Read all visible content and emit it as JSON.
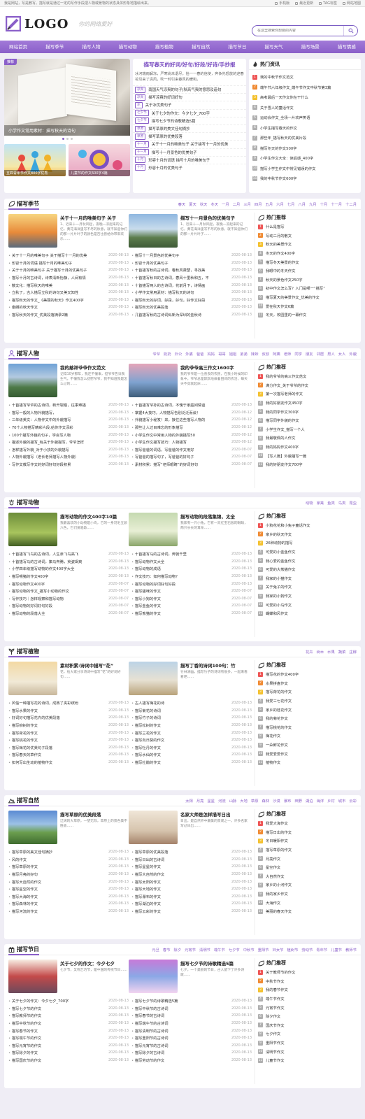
{
  "topbar": {
    "left": "我是网站，写是教写。描写就是通过一定的写作手段把人物或景物的状态具体形象地描绘出来。",
    "links": [
      "手机版",
      "最近更新",
      "TAG标签",
      "网站地图"
    ]
  },
  "header": {
    "logo": "LOGO",
    "slogan": "你的网络爱好",
    "search_placeholder": "在这里搜索你想要的内容"
  },
  "nav": [
    "网站首页",
    "描写季节",
    "描写人物",
    "描写动物",
    "描写植物",
    "描写自然",
    "描写节日",
    "描写天气",
    "描写场景",
    "描写情感"
  ],
  "hero": {
    "badge": "推荐",
    "caption": "小学作文常用素材：描写秋天的诗句",
    "thumbs": [
      "五四青年节作文800字优秀",
      "儿童节的作文600字4篇"
    ]
  },
  "center": {
    "title": "描写春天的好词/好句/好段/好诗/手抄报",
    "desc": "冰河瑞雨解冻，严寒尚未退尽，恰一一春的信使，奔争先怒放的迎春花引来了清风，吹一时引来春风的暖和。",
    "items": [
      {
        "tag": "凉爽",
        "text": "南国天气凉爽的句子|秋高气爽的意思及造句"
      },
      {
        "tag": "凉爽",
        "text": "描写凉爽的好词好句"
      },
      {
        "tag": "冰",
        "text": "关于冰优美句子"
      },
      {
        "tag": "七夕节",
        "text": "关于七夕的作文：今夕七夕_700字"
      },
      {
        "tag": "七夕节",
        "text": "描写七夕节的诗歌精选5篇"
      },
      {
        "tag": "草原",
        "text": "描写草原的美文佳句摘抄"
      },
      {
        "tag": "草原",
        "text": "描写草原的优美段落"
      },
      {
        "tag": "十一月",
        "text": "关于十一月的唯美句子 关于描写十一月的优美"
      },
      {
        "tag": "十一月",
        "text": "描写十一月景色的优美句子"
      },
      {
        "tag": "十月",
        "text": "形容十月的词语 描写十月的唯美句子"
      },
      {
        "tag": "十月",
        "text": "形容十月的优美句子"
      }
    ]
  },
  "hot": {
    "title": "热门资讯",
    "items": [
      "我的中秋节作文范文",
      "端午节六年级作文_端午节作文中秋节第3篇",
      "高考最后一天作文你在干什么",
      "关于雪人的童话作文",
      "运动会作文_全场一片欢声笑语",
      "小学生描写春天的作文",
      "那些年_描写秋天的优美片段",
      "描写冬天的作文500字",
      "小学生作文大全：读后感_400字",
      "描写小学生作文中常见错误的作文",
      "我的中秋节作文600字"
    ]
  },
  "sections": [
    {
      "title": "描写季节",
      "tags": [
        "春天",
        "夏天",
        "秋天",
        "冬天",
        "一月",
        "二月",
        "三月",
        "四月",
        "五月",
        "六月",
        "七月",
        "八月",
        "九月",
        "十月",
        "十一月",
        "十二月"
      ],
      "feat": [
        {
          "title": "关于十一月的唯美句子 关于",
          "desc": "1、近来十一月秋风起，夜晚一凉起来的记忆，黄花海洋里写不尽的秋意，就不知道你们的那一片片叶子的颜色是否也曾给你带来欢乐……"
        },
        {
          "title": "描写十一月景色的优美句子",
          "desc": "1、近来十一月秋风起，夜晚一凉起来的记忆，黄花海洋里写不尽的秋意，就不知道你们的那一片片叶子……"
        }
      ],
      "list1": [
        {
          "t": "关于十一月的唯美句子 关于描写十一月的优美",
          "d": "2020-08-13"
        },
        {
          "t": "形容十月的词语 描写十月的唯美句子",
          "d": "2020-08-13"
        },
        {
          "t": "关于十月的唯美句子 关于描写十月的优美句子",
          "d": "2020-08-13"
        },
        {
          "t": "描写十月的古诗词，诗表清新怡静，人间有情",
          "d": "2020-08-13"
        },
        {
          "t": "散文化：描写秋天的唯美",
          "d": "2020-08-13"
        },
        {
          "t": "立秋了，古人描写立秋的诗句又美又知性",
          "d": "2020-08-13"
        },
        {
          "t": "描写秋天的作文_《美丽的秋天》作文400字",
          "d": "2020-08-13"
        },
        {
          "t": "秦朗的秋天作文",
          "d": "2020-08-13"
        },
        {
          "t": "描写秋天的作文_优美段落摘录2篇",
          "d": "2020-08-13"
        }
      ],
      "list2": [
        {
          "t": "描写十一月景色的优美句子",
          "d": "2020-08-13"
        },
        {
          "t": "形容十月的优美句子",
          "d": "2020-08-13"
        },
        {
          "t": "十首描写秋的古诗词，看秋风萧瑟，寻找美",
          "d": "2020-08-13"
        },
        {
          "t": "十首描写秋日的古诗词，春风十里秋和五，不",
          "d": "2020-08-13"
        },
        {
          "t": "十首描写两人的古诗词，花前月下，诗情画",
          "d": "2020-08-13"
        },
        {
          "t": "小学作文常用素材：描写秋天的诗句",
          "d": "2020-08-13"
        },
        {
          "t": "描写秋天的好词，好段，好句，好作文好段",
          "d": "2020-08-13"
        },
        {
          "t": "描写秋天的优美段落",
          "d": "2020-08-13"
        },
        {
          "t": "几首描写秋的古诗词似新为深圳的金秋诗",
          "d": "2020-08-13"
        }
      ],
      "rec": [
        "什么是描写",
        "写动二月的散文",
        "秋天的美景作文",
        "冬天的作文400字",
        "描写冬天美景的作文",
        "我眼中的冬天作文",
        "秋天的景色作文250字",
        "初中作文怎么写？入门是哪一“描写”",
        "描写夏天的美景作文_优美的作文",
        "爱在秋天作文6篇",
        "冬天，校园里的一幕作文"
      ]
    },
    {
      "title": "描写人物",
      "tags": [
        "爷爷",
        "奶奶",
        "外公",
        "外婆",
        "爸爸",
        "妈妈",
        "哥哥",
        "姐姐",
        "弟弟",
        "妹妹",
        "叔叔",
        "阿姨",
        "老师",
        "同学",
        "朋友",
        "邻居",
        "男人",
        "女人",
        "外貌"
      ],
      "feat": [
        {
          "title": "我的慈祥爷爷作文范文",
          "desc": "记得10岁那年，我还不懂事，但爷爷告诉我生气，不懂我怎么抚慰爷爷，我不知道我是怎么过的……"
        },
        {
          "title": "我的爷爷高三作文1600字",
          "desc": "我的爷爷是一位善良的农民，在我小时候的印象中，爷爷总是默默地做着田间的农活，每天天不亮就起床……"
        }
      ],
      "list1": [
        {
          "t": "十首描写爷爷的古诗词，新开裂痕，往事难描",
          "d": "2020-08-13"
        },
        {
          "t": "描写一般的人物外貌描写，",
          "d": "2020-08-13"
        },
        {
          "t": "三年级美文：人物作文中的外貌描写",
          "d": "2020-08-13"
        },
        {
          "t": "70个人物描写精彩片段,给你作文添彩",
          "d": "2020-08-13"
        },
        {
          "t": "100个描写外貌的句子，学会写人物",
          "d": "2020-08-13"
        },
        {
          "t": "描述外貌的描写_有关于外貌描写，爷爷怎样",
          "d": "2020-08-13"
        },
        {
          "t": "怎样描写外貌_对于小孩的外貌描写",
          "d": "2020-08-13"
        },
        {
          "t": "人物外貌描写（老长老师描写人物外貌）",
          "d": "2020-08-13"
        },
        {
          "t": "写作文教写作文的好词好句好段积累",
          "d": "2020-08-13"
        }
      ],
      "list2": [
        {
          "t": "十首描写爷孙的古诗词，不愧于家庭间情谊",
          "d": "2020-08-13"
        },
        {
          "t": "掌握4大技巧，人物描写告别泛泛而谈！",
          "d": "2020-08-12"
        },
        {
          "t": "外貌描写小秘笈！来，接住这些描写人物的",
          "d": "2020-08-12"
        },
        {
          "t": "那些让人过目难忘的形象描写",
          "d": "2020-08-12"
        },
        {
          "t": "小学生作文中常用人物的外貌描写50",
          "d": "2020-08-12"
        },
        {
          "t": "小学生作文描写技巧：人物描写",
          "d": "2020-08-12"
        },
        {
          "t": "描写爸爸的词语，写爸爸的作文用好",
          "d": "2020-08-07"
        },
        {
          "t": "写爸爸的描写句子，写爸爸的好句子",
          "d": "2020-08-07"
        },
        {
          "t": "素材积累：描写“老师眼睛”的好词好句",
          "d": "2020-08-07"
        }
      ],
      "rec": [
        "我的爷爷的高三作文范文",
        "满分作文_关于爷爷的作文",
        "第一次描写老师的作文",
        "我的好朋友作文450字",
        "我的同学作文300字",
        "描写同学外貌的作文",
        "小学生作文_描写一个人",
        "我最敬佩的人作文",
        "我的妈妈作文400字",
        "【写人篇】外貌描写一篇",
        "我的好朋友作文700字"
      ]
    },
    {
      "title": "描写动物",
      "tags": [
        "动物",
        "家禽",
        "鱼类",
        "鸟类",
        "昆虫"
      ],
      "feat": [
        {
          "title": "描写动物的作文400字10篇",
          "desc": "我最喜欢的小动物是小鸟，它的一身羽毛五颜六色，它们爱唱歌……"
        },
        {
          "title": "描写动物的段落集锦，太全",
          "desc": "我家有一只小兔，它有一双红宝石般的眼睛，两只长长的耳朵……"
        }
      ],
      "list1": [
        {
          "t": "十首描写飞鸟的古诗词，人生亲飞鸟高飞",
          "d": "2020-08-13"
        },
        {
          "t": "十首描写马的古诗词，策马奔腾，英姿飒爽",
          "d": "2020-08-13"
        },
        {
          "t": "小学四年级描写动物的作文400字大全",
          "d": "2020-08-13"
        },
        {
          "t": "描写喂猪的作文400字",
          "d": "2020-08-13"
        },
        {
          "t": "描写动物作文400字",
          "d": "2020-08-07"
        },
        {
          "t": "描写动物的作文_描写小动物的作文",
          "d": "2020-08-07"
        },
        {
          "t": "写作技巧｜怎样观察和描写动物",
          "d": "2020-08-07"
        },
        {
          "t": "描写动物的好词好句好段",
          "d": "2020-08-07"
        },
        {
          "t": "描写动物的段落大全",
          "d": "2020-08-07"
        }
      ],
      "list2": [
        {
          "t": "十首描写马的古诗词，奔驰千里",
          "d": "2020-08-13"
        },
        {
          "t": "描写动物作文大全",
          "d": "2020-08-13"
        },
        {
          "t": "描写动物的成语",
          "d": "2020-08-13"
        },
        {
          "t": "作文技巧：如何描写动物？",
          "d": "2020-08-13"
        },
        {
          "t": "描写动物的好词好句好段",
          "d": "2020-08-13"
        },
        {
          "t": "描写猫咪的作文",
          "d": "2020-08-07"
        },
        {
          "t": "描写小狗的作文",
          "d": "2020-08-07"
        },
        {
          "t": "描写金鱼的作文",
          "d": "2020-08-07"
        },
        {
          "t": "描写熊猫的作文",
          "d": "2020-08-07"
        }
      ],
      "rec": [
        "小狗花花和小兔子童话作文",
        "家乡的秋天作文",
        "26种动物的描写",
        "可爱的小金鱼作文",
        "我心爱的金鱼作文",
        "可爱的大熊猫作文",
        "我家的小猫作文",
        "关于兔子的作文",
        "我家的小狗作文",
        "可爱的小鸟作文",
        "蝴蝶和风作文"
      ]
    },
    {
      "title": "描写植物",
      "tags": [
        "花卉",
        "树木",
        "水果",
        "蔬菜",
        "庄稼"
      ],
      "feat": [
        {
          "title": "素材积累:诗词中描写“花”",
          "desc": "花，给大家分享诗词中描写“花”的好词好句……"
        },
        {
          "title": "描写丁香的诗词100句：竹",
          "desc": "竹林清幽，描写竹子的诗词有很多，一起来看看吧……"
        }
      ],
      "list1": [
        {
          "t": "风信一种描写花的诗词，成熟了夹彩缤纷",
          "d": "2020-08-13"
        },
        {
          "t": "描写水果的作文",
          "d": "2020-08-13"
        },
        {
          "t": "好词好句描写花卉的优美段落",
          "d": "2020-08-13"
        },
        {
          "t": "描写柳树的作文",
          "d": "2020-08-13"
        },
        {
          "t": "描写荷花的作文",
          "d": "2020-08-13"
        },
        {
          "t": "描写桃花的作文",
          "d": "2020-08-13"
        },
        {
          "t": "描写梅花的优美句子段落",
          "d": "2020-08-13"
        },
        {
          "t": "描写春天的草作文",
          "d": "2020-08-13"
        },
        {
          "t": "如何写出生动的植物作文",
          "d": "2020-08-13"
        }
      ],
      "list2": [
        {
          "t": "古人描写梅花的诗",
          "d": "2020-08-13"
        },
        {
          "t": "描写菊花的诗词",
          "d": "2020-08-13"
        },
        {
          "t": "描写竹子的诗词",
          "d": "2020-08-13"
        },
        {
          "t": "描写松树的作文",
          "d": "2020-08-13"
        },
        {
          "t": "描写兰花的作文",
          "d": "2020-08-13"
        },
        {
          "t": "描写向日葵的作文",
          "d": "2020-08-13"
        },
        {
          "t": "描写牡丹的作文",
          "d": "2020-08-13"
        },
        {
          "t": "描写水仙的作文",
          "d": "2020-08-13"
        },
        {
          "t": "描写杜鹃的作文",
          "d": "2020-08-13"
        }
      ],
      "rec": [
        "描写花的作文400字",
        "水果拼盘作文",
        "描写荷花的作文",
        "我爱三七花作文",
        "家乡的桂花作文",
        "我的菊花作文",
        "描写桃花的作文",
        "梅花作文",
        "一朵鲜花作文",
        "我爱爱爱作文",
        "植物作文"
      ]
    },
    {
      "title": "描写自然",
      "tags": [
        "太阳",
        "月亮",
        "星星",
        "河流",
        "山脉",
        "大地",
        "草原",
        "森林",
        "沙漠",
        "瀑布",
        "田野",
        "湖泊",
        "海洋",
        "乡村",
        "城市",
        "云彩"
      ],
      "feat": [
        {
          "title": "描写草原的优美段落",
          "desc": "辽阔的大草原，一望无际，草原上的景色美不胜收……"
        },
        {
          "title": "名家大师是怎样描写日出",
          "desc": "日出，是自然界中最美的景观之一，许多名家写过日出……"
        }
      ],
      "list1": [
        {
          "t": "描写草原的美文佳句摘抄",
          "d": "2020-08-13"
        },
        {
          "t": "风的作文",
          "d": "2020-08-13"
        },
        {
          "t": "描写草原的作文",
          "d": "2020-08-13"
        },
        {
          "t": "描写月亮的好句",
          "d": "2020-08-13"
        },
        {
          "t": "描写大自然的作文",
          "d": "2020-08-13"
        },
        {
          "t": "描写星空的作文",
          "d": "2020-08-13"
        },
        {
          "t": "描写大海的作文",
          "d": "2020-08-13"
        },
        {
          "t": "描写森林的作文",
          "d": "2020-08-13"
        },
        {
          "t": "描写河流的作文",
          "d": "2020-08-13"
        }
      ],
      "list2": [
        {
          "t": "描写草原的优美段落",
          "d": "2020-08-13"
        },
        {
          "t": "描写日出的古诗词",
          "d": "2020-08-13"
        },
        {
          "t": "描写星星的作文",
          "d": "2020-08-13"
        },
        {
          "t": "描写大自然的作文",
          "d": "2020-08-13"
        },
        {
          "t": "描写太阳的作文",
          "d": "2020-08-13"
        },
        {
          "t": "描写大地的作文",
          "d": "2020-08-13"
        },
        {
          "t": "描写瀑布的作文",
          "d": "2020-08-13"
        },
        {
          "t": "描写湖泊的作文",
          "d": "2020-08-13"
        },
        {
          "t": "描写云彩的作文",
          "d": "2020-08-13"
        }
      ],
      "rec": [
        "我爱大海作文",
        "描写日出的作文",
        "冬日暖阳作文",
        "描写草原的作文",
        "月亮作文",
        "星空作文",
        "大自然作文",
        "家乡的小河作文",
        "我的家乡作文",
        "大海作文",
        "美丽的春天作文"
      ]
    },
    {
      "title": "描写节日",
      "tags": [
        "元旦",
        "春节",
        "除夕",
        "元宵节",
        "清明节",
        "端午节",
        "七夕节",
        "中秋节",
        "重阳节",
        "妇女节",
        "植树节",
        "劳动节",
        "青年节",
        "儿童节",
        "教师节"
      ],
      "feat": [
        {
          "title": "关于七夕的作文：今夕七夕",
          "desc": "七夕节，又称乞巧节，是中国的传统节日……"
        },
        {
          "title": "描写七夕节的诗歌精选5篇",
          "desc": "七夕，一个美丽的节日，古人留下了许多诗歌……"
        }
      ],
      "list1": [
        {
          "t": "关于七夕的作文：今夕七夕_700字",
          "d": "2020-08-13"
        },
        {
          "t": "描写七夕节的作文",
          "d": "2020-08-13"
        },
        {
          "t": "描写教师节的作文",
          "d": "2020-08-13"
        },
        {
          "t": "描写中秋节的作文",
          "d": "2020-08-13"
        },
        {
          "t": "描写春节的作文",
          "d": "2020-08-13"
        },
        {
          "t": "描写端午节的作文",
          "d": "2020-08-13"
        },
        {
          "t": "描写元宵节的作文",
          "d": "2020-08-13"
        },
        {
          "t": "描写除夕的作文",
          "d": "2020-08-13"
        },
        {
          "t": "描写国庆节的作文",
          "d": "2020-08-13"
        }
      ],
      "list2": [
        {
          "t": "描写七夕节的诗歌精选5篇",
          "d": "2020-08-13"
        },
        {
          "t": "描写中秋节的古诗词",
          "d": "2020-08-13"
        },
        {
          "t": "描写春节的古诗词",
          "d": "2020-08-13"
        },
        {
          "t": "描写端午节的古诗词",
          "d": "2020-08-13"
        },
        {
          "t": "描写清明节的古诗词",
          "d": "2020-08-13"
        },
        {
          "t": "描写重阳节的古诗词",
          "d": "2020-08-13"
        },
        {
          "t": "描写元宵节的古诗词",
          "d": "2020-08-13"
        },
        {
          "t": "描写除夕的古诗词",
          "d": "2020-08-13"
        },
        {
          "t": "描写劳动节的作文",
          "d": "2020-08-13"
        }
      ],
      "rec": [
        "关于教师节的作文",
        "中秋节作文",
        "我的春节作文",
        "端午节作文",
        "元宵节作文",
        "除夕作文",
        "国庆节作文",
        "七夕作文",
        "重阳节作文",
        "清明节作文",
        "儿童节作文"
      ]
    }
  ]
}
